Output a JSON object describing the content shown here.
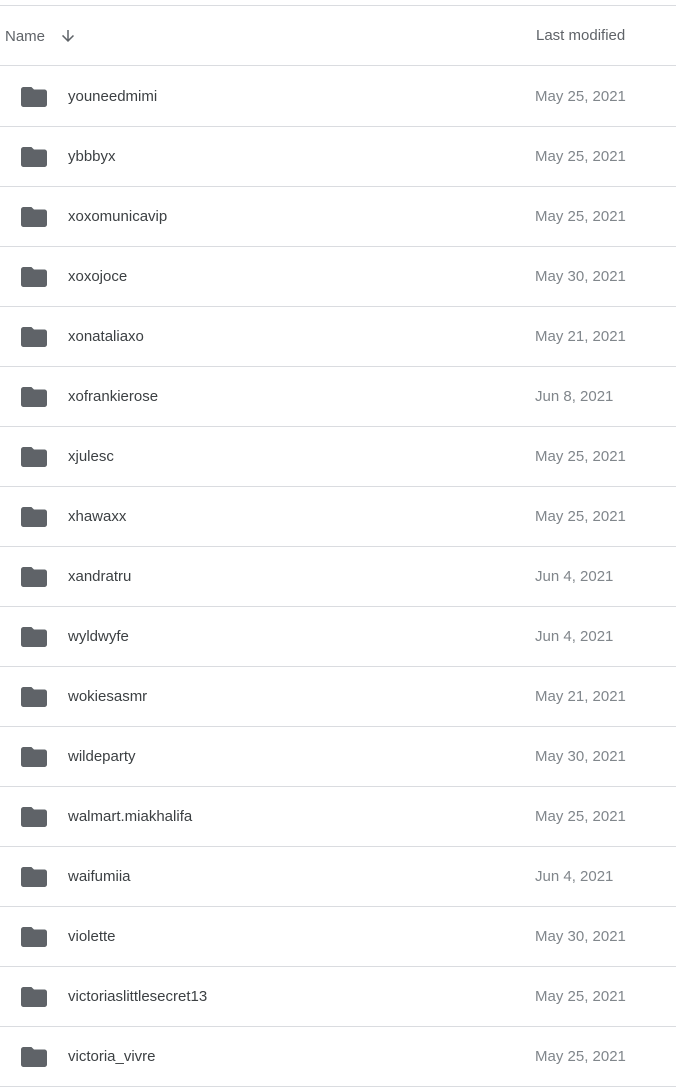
{
  "header": {
    "name_label": "Name",
    "modified_label": "Last modified",
    "sort_icon": "arrow-down-icon"
  },
  "colors": {
    "icon": "#5f6368",
    "name_text": "#3c4043",
    "date_text": "#80868b",
    "divider": "#dadce0"
  },
  "rows": [
    {
      "name": "youneedmimi",
      "modified": "May 25, 2021",
      "icon": "folder-icon"
    },
    {
      "name": "ybbbyx",
      "modified": "May 25, 2021",
      "icon": "folder-icon"
    },
    {
      "name": "xoxomunicavip",
      "modified": "May 25, 2021",
      "icon": "folder-icon"
    },
    {
      "name": "xoxojoce",
      "modified": "May 30, 2021",
      "icon": "folder-icon"
    },
    {
      "name": "xonataliaxo",
      "modified": "May 21, 2021",
      "icon": "folder-icon"
    },
    {
      "name": "xofrankierose",
      "modified": "Jun 8, 2021",
      "icon": "folder-icon"
    },
    {
      "name": "xjulesc",
      "modified": "May 25, 2021",
      "icon": "folder-icon"
    },
    {
      "name": "xhawaxx",
      "modified": "May 25, 2021",
      "icon": "folder-icon"
    },
    {
      "name": "xandratru",
      "modified": "Jun 4, 2021",
      "icon": "folder-icon"
    },
    {
      "name": "wyldwyfe",
      "modified": "Jun 4, 2021",
      "icon": "folder-icon"
    },
    {
      "name": "wokiesasmr",
      "modified": "May 21, 2021",
      "icon": "folder-icon"
    },
    {
      "name": "wildeparty",
      "modified": "May 30, 2021",
      "icon": "folder-icon"
    },
    {
      "name": "walmart.miakhalifa",
      "modified": "May 25, 2021",
      "icon": "folder-icon"
    },
    {
      "name": "waifumiia",
      "modified": "Jun 4, 2021",
      "icon": "folder-icon"
    },
    {
      "name": "violette",
      "modified": "May 30, 2021",
      "icon": "folder-icon"
    },
    {
      "name": "victoriaslittlesecret13",
      "modified": "May 25, 2021",
      "icon": "folder-icon"
    },
    {
      "name": "victoria_vivre",
      "modified": "May 25, 2021",
      "icon": "folder-icon"
    }
  ]
}
